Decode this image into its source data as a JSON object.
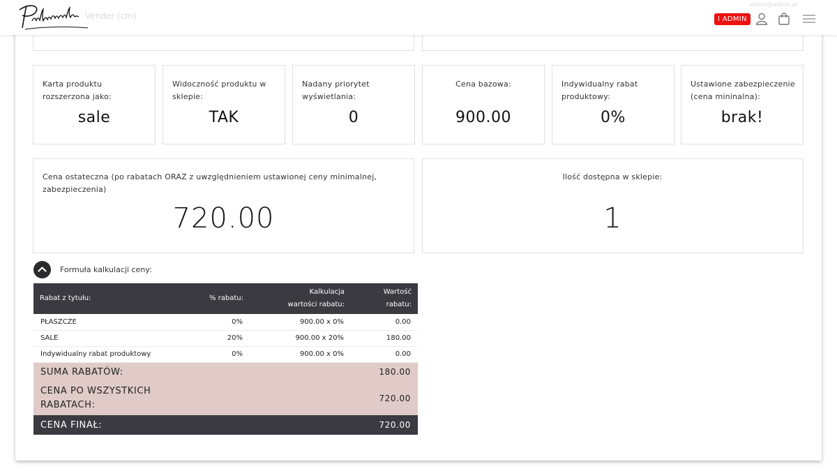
{
  "header": {
    "ghost_text": "Vender (cm)",
    "ghost_mail": "admin@admin.pl",
    "admin_badge": "I ADMIN",
    "icons": [
      "user-icon",
      "shopping-bag-icon",
      "hamburger-menu-icon"
    ]
  },
  "stats": [
    {
      "label": "Karta produktu rozszerzona jako:",
      "value": "sale"
    },
    {
      "label": "Widoczność produktu w sklepie:",
      "value": "TAK"
    },
    {
      "label": "Nadany priorytet wyświetlania:",
      "value": "0"
    },
    {
      "label": "Cena bazowa:",
      "value": "900.00"
    },
    {
      "label": "Indywidualny rabat produktowy:",
      "value": "0%"
    },
    {
      "label": "Ustawione zabezpieczenie (cena mininalna):",
      "value": "brak!"
    }
  ],
  "final_price": {
    "label": "Cena ostateczna (po rabatach ORAZ z uwzględnieniem ustawionej ceny minimalnej, zabezpieczenia)",
    "value": "720.00"
  },
  "stock": {
    "label": "Ilość dostępna w sklepie:",
    "value": "1"
  },
  "formula": {
    "label": "Formuła kalkulacji ceny:",
    "columns": [
      "Rabat z tytułu:",
      "% rabatu:",
      "Kalkulacja wartości rabatu:",
      "Wartość rabatu:"
    ],
    "rows": [
      {
        "name": "PŁASZCZE",
        "pct": "0%",
        "calc": "900.00 x 0%",
        "value": "0.00"
      },
      {
        "name": "SALE",
        "pct": "20%",
        "calc": "900.00 x 20%",
        "value": "180.00"
      },
      {
        "name": "Indywidualny rabat produktowy",
        "pct": "0%",
        "calc": "900.00 x 0%",
        "value": "0.00"
      }
    ],
    "sum_label": "SUMA RABATÓW:",
    "sum_value": "180.00",
    "after_label": "CENA PO WSZYSTKICH RABATACH:",
    "after_value": "720.00",
    "final_label": "CENA FINAŁ:",
    "final_value": "720.00"
  },
  "colors": {
    "accent_red": "#ee1111",
    "dark": "#3a3a40",
    "pink": "#e0cbc9"
  }
}
